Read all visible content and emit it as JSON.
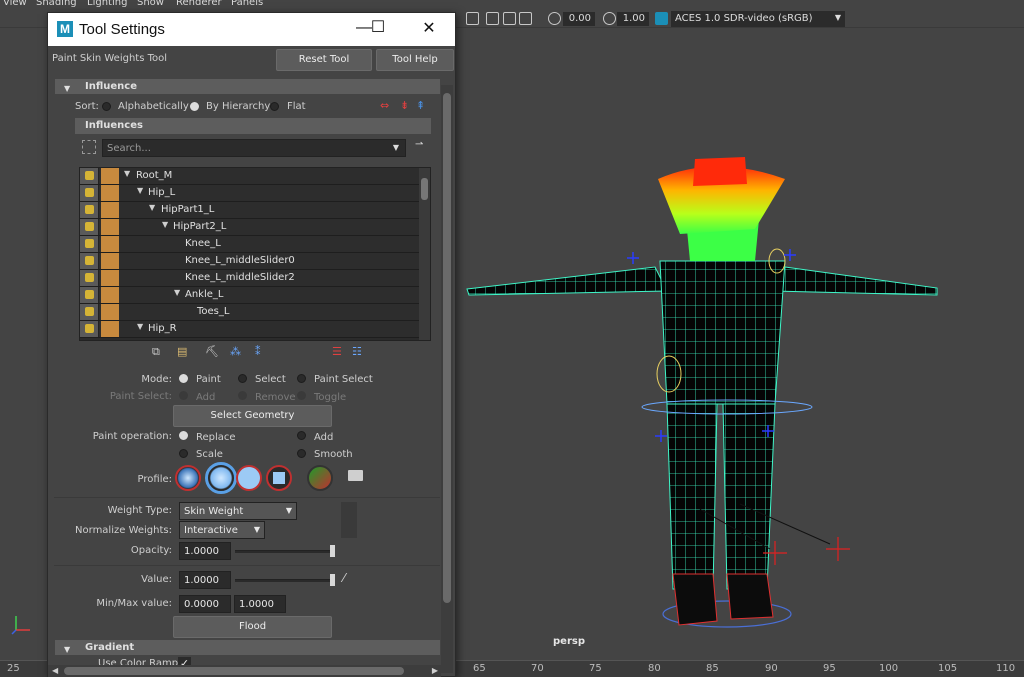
{
  "menubar": [
    "View",
    "Shading",
    "Lighting",
    "Show",
    "Renderer",
    "Panels"
  ],
  "viewport_toolbar": {
    "exposure_value": "0.00",
    "gamma_value": "1.00",
    "color_space": "ACES 1.0 SDR-video (sRGB)"
  },
  "window": {
    "title": "Tool Settings",
    "tool_name": "Paint Skin Weights Tool",
    "reset_label": "Reset Tool",
    "help_label": "Tool Help"
  },
  "influence_section": {
    "header": "Influence",
    "sort_label": "Sort:",
    "sort_options": [
      "Alphabetically",
      "By Hierarchy",
      "Flat"
    ],
    "sort_selected": "By Hierarchy",
    "influences_header": "Influences",
    "search_placeholder": "Search...",
    "tree": [
      {
        "name": "Root_M",
        "depth": 0
      },
      {
        "name": "Hip_L",
        "depth": 1
      },
      {
        "name": "HipPart1_L",
        "depth": 2
      },
      {
        "name": "HipPart2_L",
        "depth": 3
      },
      {
        "name": "Knee_L",
        "depth": 4
      },
      {
        "name": "Knee_L_middleSlider0",
        "depth": 4
      },
      {
        "name": "Knee_L_middleSlider2",
        "depth": 4
      },
      {
        "name": "Ankle_L",
        "depth": 4
      },
      {
        "name": "Toes_L",
        "depth": 5
      },
      {
        "name": "Hip_R",
        "depth": 1
      }
    ]
  },
  "mode": {
    "label": "Mode:",
    "options": [
      "Paint",
      "Select",
      "Paint Select"
    ],
    "selected": "Paint",
    "paint_select_label": "Paint Select:",
    "paint_select_options": [
      "Add",
      "Remove",
      "Toggle"
    ],
    "select_geometry_label": "Select Geometry"
  },
  "paint_operation": {
    "label": "Paint operation:",
    "options": [
      "Replace",
      "Add",
      "Scale",
      "Smooth"
    ],
    "selected": "Replace"
  },
  "profile_label": "Profile:",
  "weight_type": {
    "label": "Weight Type:",
    "value": "Skin Weight"
  },
  "normalize": {
    "label": "Normalize Weights:",
    "value": "Interactive"
  },
  "opacity": {
    "label": "Opacity:",
    "value": "1.0000",
    "level": 1.0
  },
  "value": {
    "label": "Value:",
    "value": "1.0000",
    "level": 1.0
  },
  "minmax": {
    "label": "Min/Max value:",
    "min": "0.0000",
    "max": "1.0000"
  },
  "flood_label": "Flood",
  "gradient": {
    "header": "Gradient",
    "use_color_ramp_label": "Use Color Ramp"
  },
  "viewport": {
    "camera_label": "persp"
  },
  "timeline_ticks": [
    "25",
    "65",
    "70",
    "75",
    "80",
    "85",
    "90",
    "95",
    "100",
    "105",
    "110"
  ],
  "colors": {
    "accent": "#1b8fb7",
    "influence_color": "#c88a3e",
    "wire": "#3ff6c8"
  }
}
